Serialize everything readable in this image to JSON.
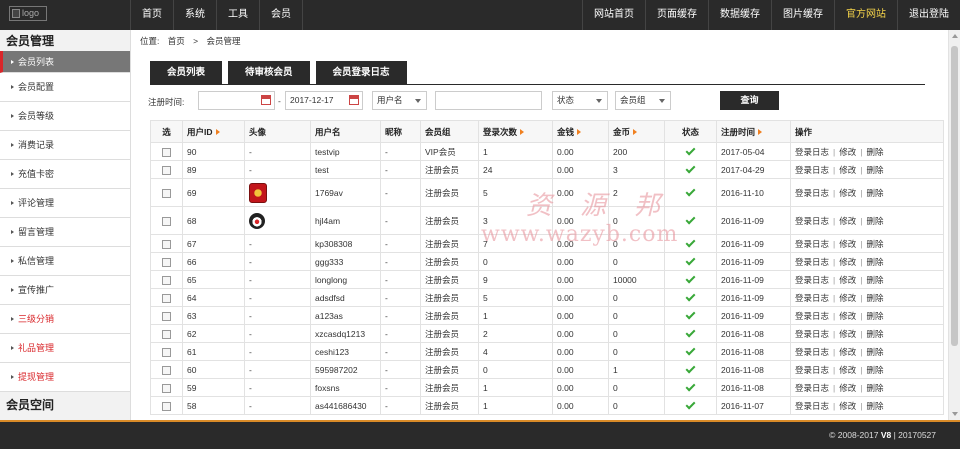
{
  "topbar": {
    "logo_alt": "logo",
    "left_nav": [
      "首页",
      "系统",
      "工具",
      "会员"
    ],
    "right_nav": [
      "网站首页",
      "页面缓存",
      "数据缓存",
      "图片缓存",
      "官方网站",
      "退出登陆"
    ]
  },
  "sidebar": {
    "title": "会员管理",
    "items": [
      {
        "label": "会员列表",
        "state": "active"
      },
      {
        "label": "会员配置",
        "state": "normal"
      },
      {
        "label": "会员等级",
        "state": "normal"
      },
      {
        "label": "消费记录",
        "state": "normal"
      },
      {
        "label": "充值卡密",
        "state": "normal"
      },
      {
        "label": "评论管理",
        "state": "normal"
      },
      {
        "label": "留言管理",
        "state": "normal"
      },
      {
        "label": "私信管理",
        "state": "normal"
      },
      {
        "label": "宣传推广",
        "state": "normal"
      },
      {
        "label": "三级分销",
        "state": "red"
      },
      {
        "label": "礼品管理",
        "state": "red"
      },
      {
        "label": "提现管理",
        "state": "red"
      }
    ],
    "title2": "会员空间"
  },
  "breadcrumb": {
    "prefix": "位置:",
    "items": [
      "首页",
      "会员管理"
    ],
    "separator": ">"
  },
  "tabs": [
    "会员列表",
    "待审核会员",
    "会员登录日志"
  ],
  "filters": {
    "label": "注册时间:",
    "date_start": "",
    "dash": "-",
    "date_end": "2017-12-17",
    "field_select": "用户名",
    "keyword": "",
    "status_select": "状态",
    "group_select": "会员组",
    "search_label": "查询"
  },
  "table": {
    "headers": [
      "选",
      "用户ID",
      "头像",
      "用户名",
      "昵称",
      "会员组",
      "登录次数",
      "金钱",
      "金币",
      "状态",
      "注册时间",
      "操作"
    ],
    "action_labels": [
      "登录日志",
      "修改",
      "删除"
    ],
    "action_separator": "|",
    "rows": [
      {
        "id": "90",
        "avatar": "-",
        "username": "testvip",
        "nickname": "-",
        "group": "VIP会员",
        "logins": "1",
        "money": "0.00",
        "coins": "200",
        "date": "2017-05-04"
      },
      {
        "id": "89",
        "avatar": "-",
        "username": "test",
        "nickname": "-",
        "group": "注册会员",
        "logins": "24",
        "money": "0.00",
        "coins": "3",
        "date": "2017-04-29"
      },
      {
        "id": "69",
        "avatar": "img1",
        "username": "1769av",
        "nickname": "-",
        "group": "注册会员",
        "logins": "5",
        "money": "0.00",
        "coins": "2",
        "date": "2016-11-10"
      },
      {
        "id": "68",
        "avatar": "img2",
        "username": "hjl4am",
        "nickname": "-",
        "group": "注册会员",
        "logins": "3",
        "money": "0.00",
        "coins": "0",
        "date": "2016-11-09"
      },
      {
        "id": "67",
        "avatar": "-",
        "username": "kp308308",
        "nickname": "-",
        "group": "注册会员",
        "logins": "7",
        "money": "0.00",
        "coins": "0",
        "date": "2016-11-09"
      },
      {
        "id": "66",
        "avatar": "-",
        "username": "ggg333",
        "nickname": "-",
        "group": "注册会员",
        "logins": "0",
        "money": "0.00",
        "coins": "0",
        "date": "2016-11-09"
      },
      {
        "id": "65",
        "avatar": "-",
        "username": "longlong",
        "nickname": "-",
        "group": "注册会员",
        "logins": "9",
        "money": "0.00",
        "coins": "10000",
        "date": "2016-11-09"
      },
      {
        "id": "64",
        "avatar": "-",
        "username": "adsdfsd",
        "nickname": "-",
        "group": "注册会员",
        "logins": "5",
        "money": "0.00",
        "coins": "0",
        "date": "2016-11-09"
      },
      {
        "id": "63",
        "avatar": "-",
        "username": "a123as",
        "nickname": "-",
        "group": "注册会员",
        "logins": "1",
        "money": "0.00",
        "coins": "0",
        "date": "2016-11-09"
      },
      {
        "id": "62",
        "avatar": "-",
        "username": "xzcasdq1213",
        "nickname": "-",
        "group": "注册会员",
        "logins": "2",
        "money": "0.00",
        "coins": "0",
        "date": "2016-11-08"
      },
      {
        "id": "61",
        "avatar": "-",
        "username": "ceshi123",
        "nickname": "-",
        "group": "注册会员",
        "logins": "4",
        "money": "0.00",
        "coins": "0",
        "date": "2016-11-08"
      },
      {
        "id": "60",
        "avatar": "-",
        "username": "595987202",
        "nickname": "-",
        "group": "注册会员",
        "logins": "0",
        "money": "0.00",
        "coins": "1",
        "date": "2016-11-08"
      },
      {
        "id": "59",
        "avatar": "-",
        "username": "foxsns",
        "nickname": "-",
        "group": "注册会员",
        "logins": "1",
        "money": "0.00",
        "coins": "0",
        "date": "2016-11-08"
      },
      {
        "id": "58",
        "avatar": "-",
        "username": "as441686430",
        "nickname": "-",
        "group": "注册会员",
        "logins": "1",
        "money": "0.00",
        "coins": "0",
        "date": "2016-11-07"
      }
    ]
  },
  "watermark": {
    "cn": "资源邦",
    "url": "www.wazyb.com"
  },
  "footer": {
    "copyright": "© 2008-2017",
    "version": "V8",
    "build": "| 20170527"
  },
  "colors": {
    "dark": "#2a2a2a",
    "accent_red": "#d9262a",
    "official_yellow": "#f4d34a",
    "sort_orange": "#f08020",
    "check_green": "#39a839"
  }
}
